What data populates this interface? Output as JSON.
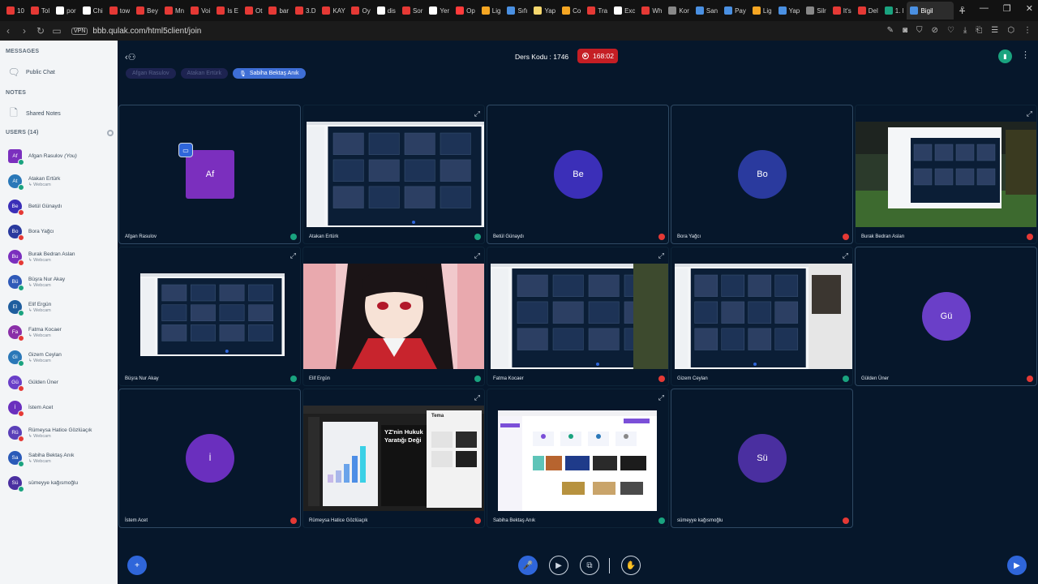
{
  "browser": {
    "tabs": [
      {
        "label": "10",
        "color": "#e53935"
      },
      {
        "label": "Tol",
        "color": "#e53935"
      },
      {
        "label": "por",
        "color": "#ffffff"
      },
      {
        "label": "Chi",
        "color": "#ffffff"
      },
      {
        "label": "tow",
        "color": "#e53935"
      },
      {
        "label": "Bey",
        "color": "#e53935"
      },
      {
        "label": "Mn",
        "color": "#e53935"
      },
      {
        "label": "Voi",
        "color": "#e53935"
      },
      {
        "label": "Is E",
        "color": "#e53935"
      },
      {
        "label": "Ot",
        "color": "#e53935"
      },
      {
        "label": "bar",
        "color": "#e53935"
      },
      {
        "label": "3.D",
        "color": "#e53935"
      },
      {
        "label": "KAY",
        "color": "#e53935"
      },
      {
        "label": "Oy",
        "color": "#e53935"
      },
      {
        "label": "dis",
        "color": "#ffffff"
      },
      {
        "label": "Sor",
        "color": "#e53935"
      },
      {
        "label": "Yer",
        "color": "#ffffff"
      },
      {
        "label": "Op",
        "color": "#ff3b3b"
      },
      {
        "label": "Lig",
        "color": "#f5a623"
      },
      {
        "label": "Sıfı",
        "color": "#4a90e2"
      },
      {
        "label": "Yap",
        "color": "#f5d76e"
      },
      {
        "label": "Co",
        "color": "#f5a623"
      },
      {
        "label": "Tra",
        "color": "#e53935"
      },
      {
        "label": "Exc",
        "color": "#ffffff"
      },
      {
        "label": "Wh",
        "color": "#e53935"
      },
      {
        "label": "Kor",
        "color": "#888888"
      },
      {
        "label": "San",
        "color": "#4a90e2"
      },
      {
        "label": "Pay",
        "color": "#4a90e2"
      },
      {
        "label": "Lig",
        "color": "#f5a623"
      },
      {
        "label": "Yap",
        "color": "#4a90e2"
      },
      {
        "label": "Silr",
        "color": "#888888"
      },
      {
        "label": "It's",
        "color": "#e53935"
      },
      {
        "label": "Del",
        "color": "#e53935"
      },
      {
        "label": "1. l",
        "color": "#1aa37f"
      },
      {
        "label": "Bigil",
        "color": "#4a90e2"
      }
    ],
    "url": "bbb.qulak.com/html5client/join",
    "vpn": "VPN"
  },
  "sidebar": {
    "messages_header": "MESSAGES",
    "public_chat": "Public Chat",
    "notes_header": "NOTES",
    "shared_notes": "Shared Notes",
    "users_header": "USERS (14)",
    "users": [
      {
        "initials": "Af",
        "name": "Afgan Rasulov",
        "you": "(You)",
        "sub": "",
        "color": "#7b2fbe",
        "mic": "#1aa37f",
        "square": true
      },
      {
        "initials": "At",
        "name": "Atakan Ertürk",
        "sub": "Webcam",
        "color": "#2a78b8",
        "mic": "#1aa37f",
        "square": false
      },
      {
        "initials": "Be",
        "name": "Betül Günaydı",
        "sub": "",
        "color": "#3b2fb8",
        "mic": "#e53935",
        "square": false
      },
      {
        "initials": "Bo",
        "name": "Bora Yağcı",
        "sub": "",
        "color": "#2a3a9e",
        "mic": "#e53935",
        "square": false
      },
      {
        "initials": "Bu",
        "name": "Burak Bedran Aslan",
        "sub": "Webcam",
        "color": "#7b2fbe",
        "mic": "#e53935",
        "square": false
      },
      {
        "initials": "Bü",
        "name": "Büşra Nur Akay",
        "sub": "Webcam",
        "color": "#2f5ab8",
        "mic": "#1aa37f",
        "square": false
      },
      {
        "initials": "El",
        "name": "Elif Ergün",
        "sub": "Webcam",
        "color": "#1f5e9e",
        "mic": "#1aa37f",
        "square": false
      },
      {
        "initials": "Fa",
        "name": "Fatma Kocaer",
        "sub": "Webcam",
        "color": "#8a2fa8",
        "mic": "#e53935",
        "square": false
      },
      {
        "initials": "Gi",
        "name": "Gizem Ceylan",
        "sub": "Webcam",
        "color": "#2a78b8",
        "mic": "#1aa37f",
        "square": false
      },
      {
        "initials": "Gü",
        "name": "Gülden Üner",
        "sub": "",
        "color": "#6a3fc8",
        "mic": "#e53935",
        "square": false
      },
      {
        "initials": "İ",
        "name": "İstem Acet",
        "sub": "",
        "color": "#6a2fbe",
        "mic": "#e53935",
        "square": false
      },
      {
        "initials": "Rü",
        "name": "Rümeysa Hatice Gözlüaçık",
        "sub": "Webcam",
        "color": "#5a3fb8",
        "mic": "#e53935",
        "square": false
      },
      {
        "initials": "Sa",
        "name": "Sabiha Bektaş Anık",
        "sub": "Webcam",
        "color": "#2a5ab8",
        "mic": "#1aa37f",
        "square": false
      },
      {
        "initials": "Sü",
        "name": "sümeyye kağısmoğlu",
        "sub": "",
        "color": "#4a2fa0",
        "mic": "#1aa37f",
        "square": false
      }
    ]
  },
  "header": {
    "course": "Ders Kodu : 1746",
    "timer": "168:02",
    "talkers": [
      "Afgan Rasulov",
      "Atakan Ertürk",
      "Sabiha Bektaş Anık"
    ]
  },
  "tiles": [
    {
      "label": "Afgan Rasulov",
      "initials": "Af",
      "kind": "presenter",
      "color": "#7b2fbe",
      "mic": "#1aa37f"
    },
    {
      "label": "Atakan Ertürk",
      "kind": "screen",
      "mic": "#1aa37f"
    },
    {
      "label": "Betül Günaydı",
      "initials": "Be",
      "kind": "avatar",
      "color": "#3b2fb8",
      "mic": "#e53935"
    },
    {
      "label": "Bora Yağcı",
      "initials": "Bo",
      "kind": "avatar",
      "color": "#2a3a9e",
      "mic": "#e53935"
    },
    {
      "label": "Burak Bedran Aslan",
      "kind": "screen",
      "mic": "#e53935"
    },
    {
      "label": "Büşra Nur Akay",
      "kind": "screen",
      "mic": "#1aa37f"
    },
    {
      "label": "Elif Ergün",
      "kind": "anime",
      "mic": "#1aa37f"
    },
    {
      "label": "Fatma Kocaer",
      "kind": "screen",
      "mic": "#e53935"
    },
    {
      "label": "Gizem Ceylan",
      "kind": "screen",
      "mic": "#1aa37f"
    },
    {
      "label": "Gülden Üner",
      "initials": "Gü",
      "kind": "avatar",
      "color": "#6a3fc8",
      "mic": "#e53935"
    },
    {
      "label": "İstem Acet",
      "initials": "İ",
      "kind": "avatar",
      "color": "#6a2fbe",
      "mic": "#e53935"
    },
    {
      "label": "Rümeysa Hatice Gözlüaçık",
      "kind": "slides",
      "mic": "#e53935"
    },
    {
      "label": "Sabiha Bektaş Anık",
      "kind": "web",
      "mic": "#1aa37f"
    },
    {
      "label": "sümeyye kağısmoğlu",
      "initials": "Sü",
      "kind": "avatar",
      "color": "#4a2fa0",
      "mic": "#e53935"
    }
  ],
  "slide_text": {
    "headline": "YZ'nin Hukuk",
    "headline2": "Yaratığı Deği",
    "panel_title": "Tema"
  }
}
